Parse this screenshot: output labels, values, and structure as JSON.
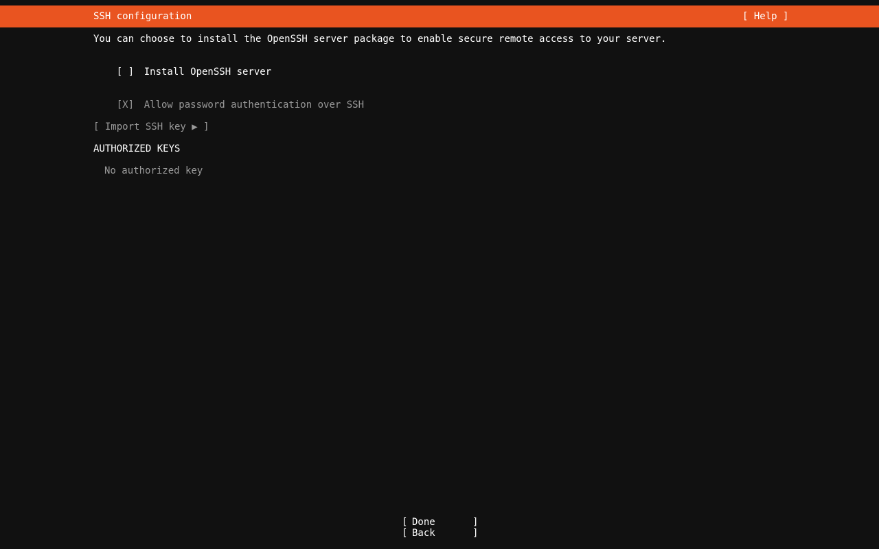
{
  "header": {
    "title": "SSH configuration",
    "help_label": "[ Help ]"
  },
  "main": {
    "intro": "You can choose to install the OpenSSH server package to enable secure remote access to your server.",
    "install_openssh": {
      "checkbox": "[ ]",
      "label": "Install OpenSSH server"
    },
    "allow_password": {
      "checkbox": "[X]",
      "label": "Allow password authentication over SSH"
    },
    "import_key_label": "[ Import SSH key ▶ ]",
    "authorized_keys_heading": "AUTHORIZED KEYS",
    "no_key_text": "No authorized key"
  },
  "footer": {
    "done_label": "Done",
    "back_label": "Back",
    "bracket_left": "[",
    "bracket_right": "]"
  },
  "colors": {
    "accent": "#e95420",
    "background": "#111111",
    "text": "#ffffff",
    "disabled_text": "#9a9a9a"
  }
}
